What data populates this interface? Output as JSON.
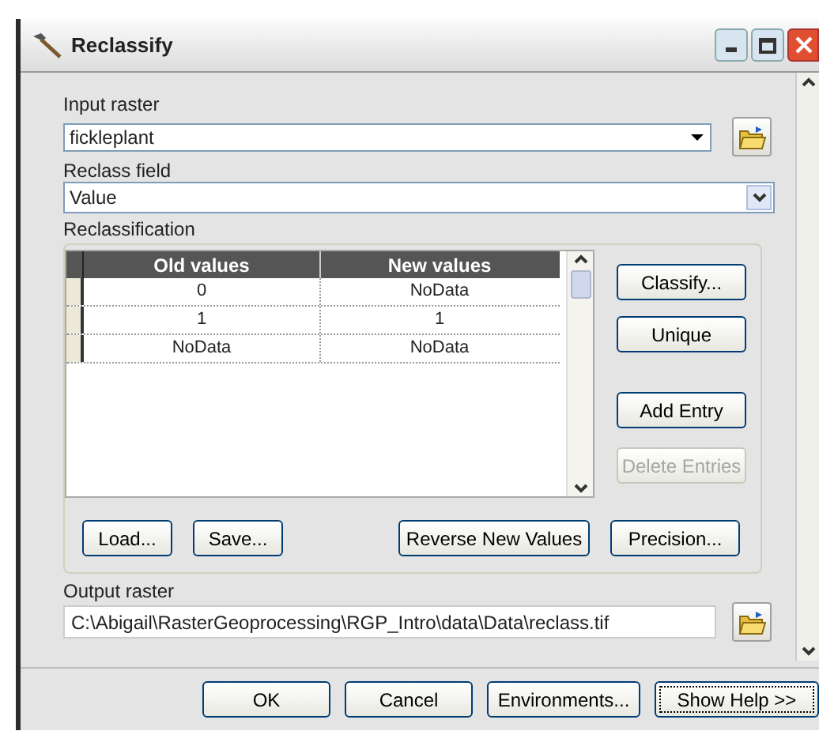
{
  "window": {
    "title": "Reclassify"
  },
  "input_raster": {
    "label": "Input raster",
    "value": "fickleplant"
  },
  "reclass_field": {
    "label": "Reclass field",
    "value": "Value"
  },
  "reclassification": {
    "label": "Reclassification",
    "table": {
      "columns": [
        "Old values",
        "New values"
      ],
      "rows": [
        [
          "0",
          "NoData"
        ],
        [
          "1",
          "1"
        ],
        [
          "NoData",
          "NoData"
        ]
      ]
    },
    "side_buttons": [
      {
        "label": "Classify...",
        "disabled": false
      },
      {
        "label": "Unique",
        "disabled": false
      },
      {
        "label": "Add Entry",
        "disabled": false
      },
      {
        "label": "Delete Entries",
        "disabled": true
      }
    ],
    "bottom_buttons": [
      "Load...",
      "Save...",
      "Reverse New Values",
      "Precision..."
    ]
  },
  "output_raster": {
    "label": "Output raster",
    "value": "C:\\Abigail\\RasterGeoprocessing\\RGP_Intro\\data\\Data\\reclass.tif"
  },
  "footer_buttons": [
    {
      "label": "OK",
      "focused": false
    },
    {
      "label": "Cancel",
      "focused": false
    },
    {
      "label": "Environments...",
      "focused": false
    },
    {
      "label": "Show Help >>",
      "focused": true
    }
  ]
}
